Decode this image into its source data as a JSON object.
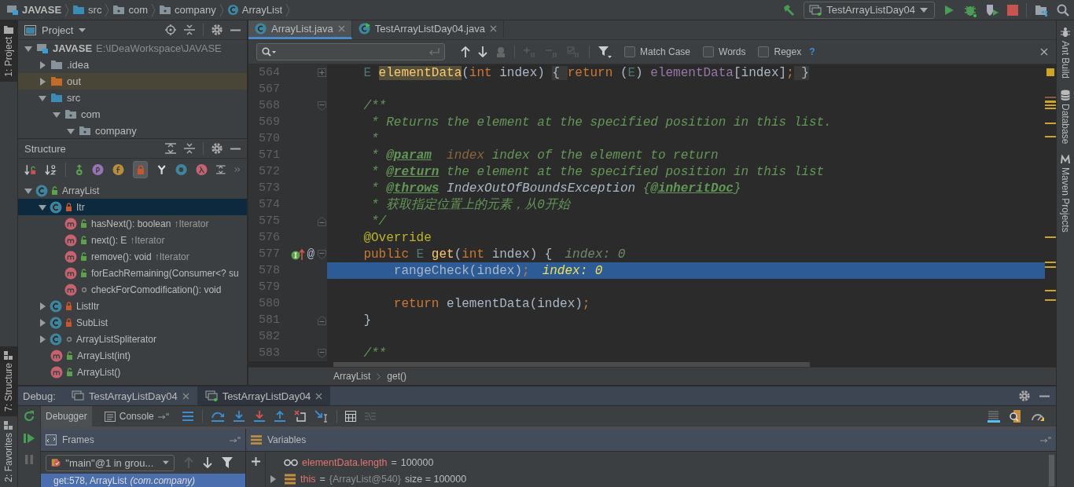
{
  "breadcrumbs": [
    {
      "label": "JAVASE",
      "kind": "module"
    },
    {
      "label": "src",
      "kind": "source"
    },
    {
      "label": "com",
      "kind": "package"
    },
    {
      "label": "company",
      "kind": "package"
    },
    {
      "label": "ArrayList",
      "kind": "class"
    }
  ],
  "run_config": {
    "label": "TestArrayListDay04"
  },
  "left_tool_windows": [
    {
      "label": "1: Project",
      "selected": true
    },
    {
      "label": "7: Structure",
      "selected": true
    },
    {
      "label": "2: Favorites",
      "selected": false
    }
  ],
  "right_tool_windows": [
    {
      "label": "Ant Build"
    },
    {
      "label": "Database"
    },
    {
      "label": "Maven Projects"
    }
  ],
  "project": {
    "title": "Project",
    "tree": [
      {
        "label": "JAVASE",
        "path": "E:\\IDeaWorkspace\\JAVASE",
        "kind": "module",
        "expanded": true,
        "selected": false,
        "children": [
          {
            "label": ".idea",
            "kind": "folder",
            "expanded": false,
            "selected": false
          },
          {
            "label": "out",
            "kind": "excluded",
            "expanded": false,
            "selected": true
          },
          {
            "label": "src",
            "kind": "source",
            "expanded": true,
            "selected": false,
            "children": [
              {
                "label": "com",
                "kind": "package",
                "expanded": true,
                "selected": false,
                "children": [
                  {
                    "label": "company",
                    "kind": "package",
                    "expanded": true,
                    "selected": false
                  }
                ]
              }
            ]
          }
        ]
      }
    ]
  },
  "structure": {
    "title": "Structure",
    "tree": [
      {
        "label": "ArrayList",
        "kind": "class",
        "access": {
          "kind": "public"
        },
        "expanded": true,
        "selected": false,
        "children": [
          {
            "label": "Itr",
            "kind": "class",
            "access": {
              "kind": "private"
            },
            "expanded": true,
            "selected": true,
            "children": [
              {
                "label": "hasNext(): boolean",
                "inherited": "↑Iterator",
                "kind": "method",
                "access": {
                  "kind": "public"
                },
                "selected": false
              },
              {
                "label": "next(): E",
                "inherited": "↑Iterator",
                "kind": "method",
                "access": {
                  "kind": "public"
                },
                "selected": false
              },
              {
                "label": "remove(): void",
                "inherited": "↑Iterator",
                "kind": "method",
                "access": {
                  "kind": "public"
                },
                "selected": false
              },
              {
                "label": "forEachRemaining(Consumer<? su",
                "kind": "method",
                "access": {
                  "kind": "public"
                },
                "selected": false
              },
              {
                "label": "checkForComodification(): void",
                "kind": "method",
                "access": {
                  "kind": "package"
                },
                "selected": false
              }
            ]
          },
          {
            "label": "ListItr",
            "kind": "class",
            "access": {
              "kind": "private"
            },
            "expanded": false,
            "selected": false
          },
          {
            "label": "SubList",
            "kind": "class",
            "access": {
              "kind": "private"
            },
            "expanded": false,
            "selected": false
          },
          {
            "label": "ArrayListSpliterator",
            "kind": "class",
            "access": {
              "kind": "package"
            },
            "expanded": false,
            "selected": false
          },
          {
            "label": "ArrayList(int)",
            "kind": "method",
            "access": {
              "kind": "public"
            },
            "selected": false
          },
          {
            "label": "ArrayList()",
            "kind": "method",
            "access": {
              "kind": "public"
            },
            "selected": false
          }
        ]
      }
    ]
  },
  "editor_tabs": [
    {
      "label": "ArrayList.java",
      "kind": "class",
      "selected": true
    },
    {
      "label": "TestArrayListDay04.java",
      "kind": "runnable",
      "selected": false
    }
  ],
  "find": {
    "options": [
      {
        "label": "Match Case",
        "checked": false
      },
      {
        "label": "Words",
        "checked": false
      },
      {
        "label": "Regex",
        "checked": false
      }
    ],
    "help": "?"
  },
  "code": {
    "lines": [
      {
        "number": "564",
        "fold": {
          "kind": "plus"
        },
        "current": false,
        "tokens": [
          {
            "kind": "type",
            "text": "    E "
          },
          {
            "kind": "usage",
            "text": "elementData"
          },
          {
            "kind": "plain",
            "text": "("
          },
          {
            "kind": "kw",
            "text": "int"
          },
          {
            "kind": "plain",
            "text": " index) "
          },
          {
            "kind": "folded",
            "text": "{ "
          },
          {
            "kind": "kw",
            "text": "return"
          },
          {
            "kind": "plain",
            "text": " ("
          },
          {
            "kind": "type",
            "text": "E"
          },
          {
            "kind": "plain",
            "text": ") "
          },
          {
            "kind": "field",
            "text": "elementData"
          },
          {
            "kind": "plain",
            "text": "[index]"
          },
          {
            "kind": "kw",
            "text": ";"
          },
          {
            "kind": "folded",
            "text": " }"
          }
        ]
      },
      {
        "number": "567",
        "current": false
      },
      {
        "number": "568",
        "fold": {
          "kind": "start"
        },
        "current": false,
        "tokens": [
          {
            "kind": "comment",
            "text": "    /**"
          }
        ]
      },
      {
        "number": "569",
        "current": false,
        "tokens": [
          {
            "kind": "comment",
            "text": "     * Returns the element at the specified position in this list."
          }
        ]
      },
      {
        "number": "570",
        "current": false,
        "tokens": [
          {
            "kind": "comment",
            "text": "     *"
          }
        ]
      },
      {
        "number": "571",
        "current": false,
        "tokens": [
          {
            "kind": "comment",
            "text": "     * "
          },
          {
            "kind": "doctag",
            "text": "@param"
          },
          {
            "kind": "docref",
            "text": "  index"
          },
          {
            "kind": "comment",
            "text": " index of the element to return"
          }
        ]
      },
      {
        "number": "572",
        "current": false,
        "tokens": [
          {
            "kind": "comment",
            "text": "     * "
          },
          {
            "kind": "doctag",
            "text": "@return"
          },
          {
            "kind": "comment",
            "text": " the element at the specified position in this list"
          }
        ]
      },
      {
        "number": "573",
        "current": false,
        "tokens": [
          {
            "kind": "comment",
            "text": "     * "
          },
          {
            "kind": "doctag",
            "text": "@throws"
          },
          {
            "kind": "docplain",
            "text": " IndexOutOfBoundsException"
          },
          {
            "kind": "comment",
            "text": " {"
          },
          {
            "kind": "doctag",
            "text": "@inheritDoc"
          },
          {
            "kind": "comment",
            "text": "}"
          }
        ]
      },
      {
        "number": "574",
        "current": false,
        "tokens": [
          {
            "kind": "comment",
            "text": "     * 获取指定位置上的元素，从0开始"
          }
        ]
      },
      {
        "number": "575",
        "fold": {
          "kind": "end"
        },
        "current": false,
        "tokens": [
          {
            "kind": "comment",
            "text": "     */"
          }
        ]
      },
      {
        "number": "576",
        "current": false,
        "tokens": [
          {
            "kind": "annotation",
            "text": "    @Override"
          }
        ]
      },
      {
        "number": "577",
        "fold": {
          "kind": "start"
        },
        "current": false,
        "overrides": true,
        "gutter_symbol": "@",
        "hint": "index: 0",
        "tokens": [
          {
            "kind": "kw",
            "text": "    public"
          },
          {
            "kind": "type",
            "text": " E"
          },
          {
            "kind": "decl",
            "text": " get"
          },
          {
            "kind": "plain",
            "text": "("
          },
          {
            "kind": "kw",
            "text": "int"
          },
          {
            "kind": "plain",
            "text": " index) {"
          }
        ]
      },
      {
        "number": "578",
        "current": true,
        "hint": "index: 0",
        "tokens": [
          {
            "kind": "plain",
            "text": "        rangeCheck(index)"
          },
          {
            "kind": "kw",
            "text": ";"
          }
        ]
      },
      {
        "number": "579",
        "current": false
      },
      {
        "number": "580",
        "current": false,
        "tokens": [
          {
            "kind": "kw",
            "text": "        return"
          },
          {
            "kind": "plain",
            "text": " elementData(index)"
          },
          {
            "kind": "kw",
            "text": ";"
          }
        ]
      },
      {
        "number": "581",
        "fold": {
          "kind": "end"
        },
        "current": false,
        "tokens": [
          {
            "kind": "plain",
            "text": "    }"
          }
        ]
      },
      {
        "number": "582",
        "current": false
      },
      {
        "number": "583",
        "fold": {
          "kind": "start"
        },
        "current": false,
        "tokens": [
          {
            "kind": "comment",
            "text": "    /**"
          }
        ]
      }
    ]
  },
  "navigation": [
    "ArrayList",
    "get()"
  ],
  "debug": {
    "label": "Debug:",
    "tabs": [
      {
        "label": "TestArrayListDay04",
        "selected": false
      },
      {
        "label": "TestArrayListDay04",
        "selected": true
      }
    ],
    "subtabs": [
      {
        "label": "Debugger",
        "selected": true
      },
      {
        "label": "Console",
        "selected": false
      }
    ],
    "frames": {
      "title": "Frames",
      "thread": "\"main\"@1 in grou...",
      "items": [
        {
          "method": "get:578, ArrayList",
          "package": "(com.company)",
          "selected": true
        }
      ]
    },
    "variables": {
      "title": "Variables",
      "items": [
        {
          "kind": "watch",
          "name": "elementData.length",
          "operator": "=",
          "value": "100000"
        },
        {
          "kind": "field",
          "name": "this",
          "operator": "=",
          "ref": "{ArrayList@540}",
          "value": "size = 100000",
          "expanded": false
        }
      ]
    }
  }
}
